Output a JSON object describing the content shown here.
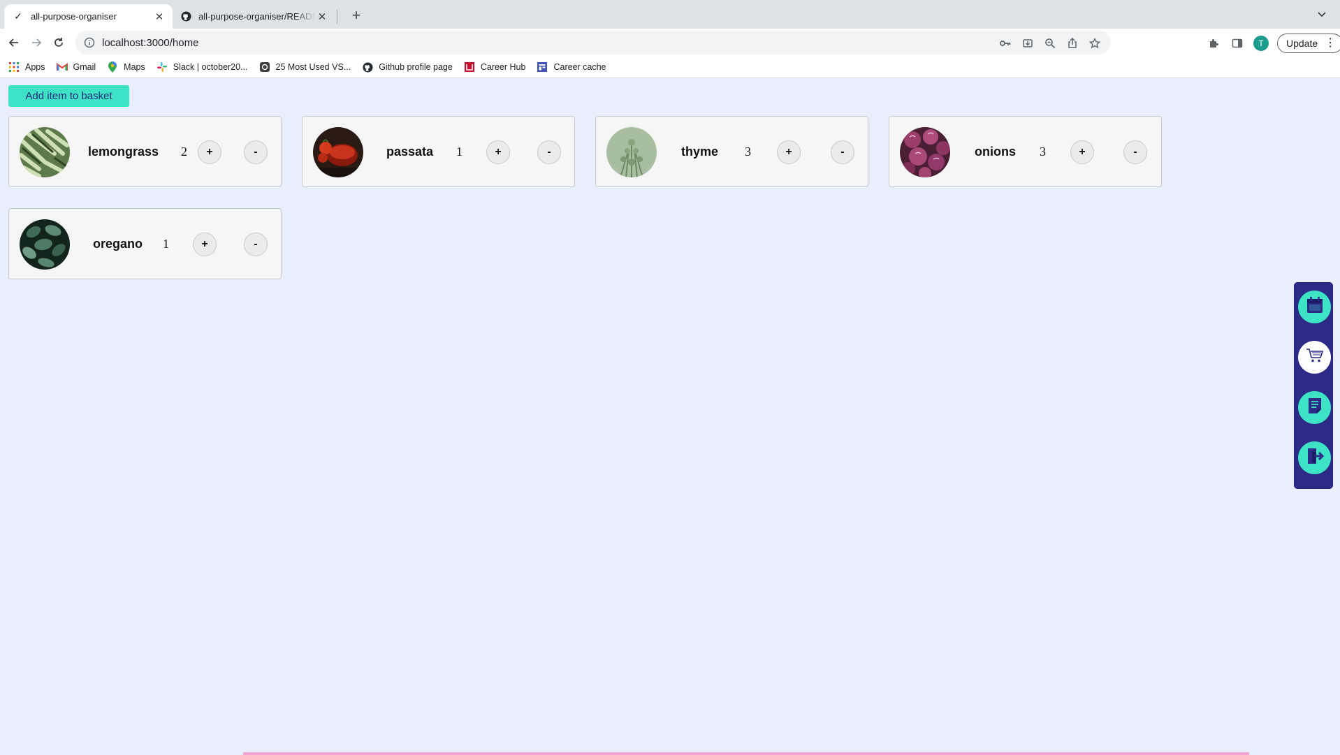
{
  "browser": {
    "tabs": [
      {
        "title": "all-purpose-organiser",
        "active": true,
        "icon": "check-icon"
      },
      {
        "title": "all-purpose-organiser/README.md",
        "active": false,
        "icon": "github-icon"
      }
    ],
    "url": "localhost:3000/home",
    "profile_initial": "T",
    "update_label": "Update",
    "bookmarks": [
      {
        "label": "Apps",
        "icon": "apps-grid-icon"
      },
      {
        "label": "Gmail",
        "icon": "gmail-icon"
      },
      {
        "label": "Maps",
        "icon": "maps-pin-icon"
      },
      {
        "label": "Slack | october20...",
        "icon": "slack-icon"
      },
      {
        "label": "25 Most Used VS...",
        "icon": "bookmark-site-icon"
      },
      {
        "label": "Github profile page",
        "icon": "github-icon"
      },
      {
        "label": "Career Hub",
        "icon": "career-hub-icon"
      },
      {
        "label": "Career cache",
        "icon": "career-cache-icon"
      }
    ]
  },
  "page": {
    "add_button_label": "Add item to basket",
    "plus_label": "+",
    "minus_label": "-",
    "items": [
      {
        "name": "lemongrass",
        "quantity": "2",
        "image": "lemongrass-photo"
      },
      {
        "name": "passata",
        "quantity": "1",
        "image": "passata-photo"
      },
      {
        "name": "thyme",
        "quantity": "3",
        "image": "thyme-photo"
      },
      {
        "name": "onions",
        "quantity": "3",
        "image": "onions-photo"
      },
      {
        "name": "oregano",
        "quantity": "1",
        "image": "oregano-photo"
      }
    ],
    "side_nav": [
      {
        "icon": "calendar-icon"
      },
      {
        "icon": "shopping-cart-icon",
        "selected": true
      },
      {
        "icon": "notes-icon"
      },
      {
        "icon": "logout-icon"
      }
    ],
    "colors": {
      "accent": "#3ee3c6",
      "nav_bg": "#2b2a86",
      "page_bg": "#e8eefb"
    }
  }
}
